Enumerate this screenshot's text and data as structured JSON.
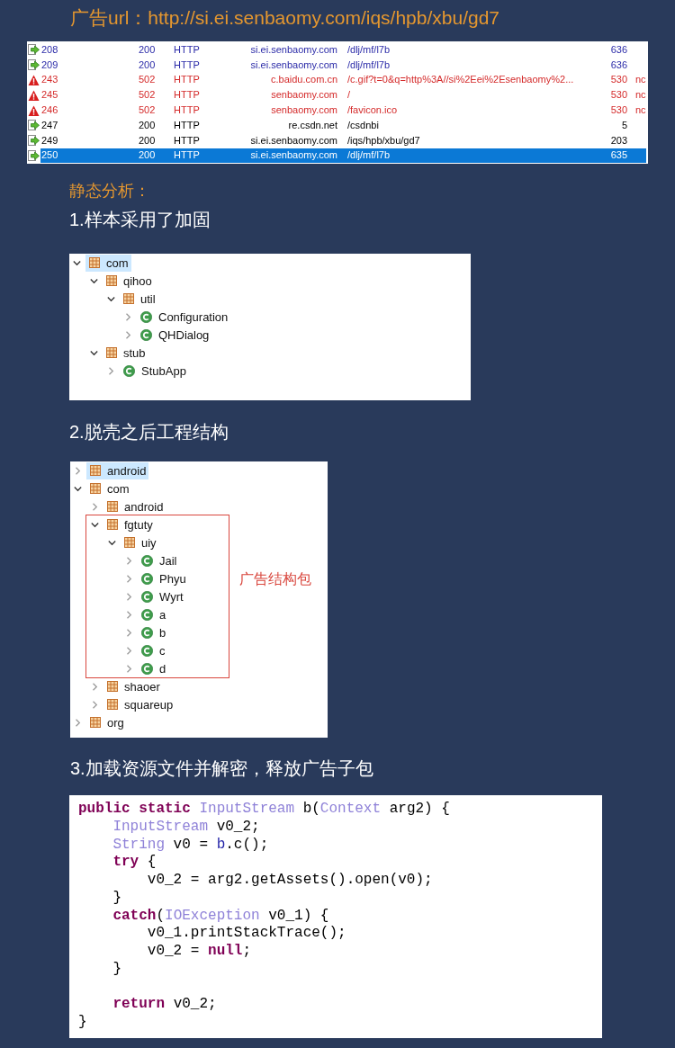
{
  "ad_url_heading": "广告url：http://si.ei.senbaomy.com/iqs/hpb/xbu/gd7",
  "sessions": {
    "rows": [
      {
        "kind": "ok",
        "selected": false,
        "color": "#2b2ba8",
        "cells": [
          "208",
          "200",
          "HTTP",
          "si.ei.senbaomy.com",
          "/dlj/mf/l7b",
          "636"
        ]
      },
      {
        "kind": "ok",
        "selected": false,
        "color": "#2b2ba8",
        "cells": [
          "209",
          "200",
          "HTTP",
          "si.ei.senbaomy.com",
          "/dlj/mf/l7b",
          "636"
        ]
      },
      {
        "kind": "error",
        "selected": false,
        "color": "#d42a2a",
        "cells": [
          "243",
          "502",
          "HTTP",
          "c.baidu.com.cn",
          "/c.gif?t=0&q=http%3A//si%2Eei%2Esenbaomy%2...",
          "530",
          "nc"
        ]
      },
      {
        "kind": "error",
        "selected": false,
        "color": "#d42a2a",
        "cells": [
          "245",
          "502",
          "HTTP",
          "senbaomy.com",
          "/",
          "530",
          "nc"
        ]
      },
      {
        "kind": "error",
        "selected": false,
        "color": "#d42a2a",
        "cells": [
          "246",
          "502",
          "HTTP",
          "senbaomy.com",
          "/favicon.ico",
          "530",
          "nc"
        ]
      },
      {
        "kind": "ok",
        "selected": false,
        "color": "#000000",
        "cells": [
          "247",
          "200",
          "HTTP",
          "re.csdn.net",
          "/csdnbi",
          "5"
        ]
      },
      {
        "kind": "ok",
        "selected": false,
        "color": "#000000",
        "cells": [
          "249",
          "200",
          "HTTP",
          "si.ei.senbaomy.com",
          "/iqs/hpb/xbu/gd7",
          "203"
        ]
      },
      {
        "kind": "ok",
        "selected": true,
        "cells": [
          "250",
          "200",
          "HTTP",
          "si.ei.senbaomy.com",
          "/dlj/mf/l7b",
          "635"
        ]
      }
    ]
  },
  "analysis_heading": "静态分析：",
  "steps": [
    {
      "title": "1.样本采用了加固",
      "kind": "tree",
      "tree": [
        {
          "label": "com",
          "kind": "package",
          "expanded": true,
          "selected": true,
          "children": [
            {
              "label": "qihoo",
              "kind": "package",
              "expanded": true,
              "selected": false,
              "children": [
                {
                  "label": "util",
                  "kind": "package",
                  "expanded": true,
                  "selected": false,
                  "children": [
                    {
                      "label": "Configuration",
                      "kind": "class",
                      "expanded": false,
                      "selected": false
                    },
                    {
                      "label": "QHDialog",
                      "kind": "class",
                      "expanded": false,
                      "selected": false
                    }
                  ]
                }
              ]
            },
            {
              "label": "stub",
              "kind": "package",
              "expanded": true,
              "selected": false,
              "children": [
                {
                  "label": "StubApp",
                  "kind": "class",
                  "expanded": false,
                  "selected": false
                }
              ]
            }
          ]
        }
      ]
    },
    {
      "title": "2.脱壳之后工程结构",
      "kind": "tree",
      "tree": [
        {
          "label": "android",
          "kind": "package",
          "expanded": false,
          "selected": true
        },
        {
          "label": "com",
          "kind": "package",
          "expanded": true,
          "selected": false,
          "children": [
            {
              "label": "android",
              "kind": "package",
              "expanded": false,
              "selected": false
            },
            {
              "label": "fgtuty",
              "kind": "package",
              "expanded": true,
              "selected": false,
              "callout": "广告结构包",
              "children": [
                {
                  "label": "uiy",
                  "kind": "package",
                  "expanded": true,
                  "selected": false,
                  "children": [
                    {
                      "label": "Jail",
                      "kind": "class",
                      "expanded": false,
                      "selected": false
                    },
                    {
                      "label": "Phyu",
                      "kind": "class",
                      "expanded": false,
                      "selected": false
                    },
                    {
                      "label": "Wyrt",
                      "kind": "class",
                      "expanded": false,
                      "selected": false
                    },
                    {
                      "label": "a",
                      "kind": "class",
                      "expanded": false,
                      "selected": false
                    },
                    {
                      "label": "b",
                      "kind": "class",
                      "expanded": false,
                      "selected": false
                    },
                    {
                      "label": "c",
                      "kind": "class",
                      "expanded": false,
                      "selected": false
                    },
                    {
                      "label": "d",
                      "kind": "class",
                      "expanded": false,
                      "selected": false
                    }
                  ]
                }
              ]
            },
            {
              "label": "shaoer",
              "kind": "package",
              "expanded": false,
              "selected": false
            },
            {
              "label": "squareup",
              "kind": "package",
              "expanded": false,
              "selected": false
            }
          ]
        },
        {
          "label": "org",
          "kind": "package",
          "expanded": false,
          "selected": false
        }
      ]
    },
    {
      "title": "3.加载资源文件并解密，释放广告子包",
      "kind": "code",
      "code": [
        {
          "kind": "code",
          "tokens": [
            {
              "text": "public static ",
              "kind": "keyword"
            },
            {
              "text": "InputStream",
              "kind": "type"
            },
            {
              "text": " b(",
              "kind": "plain"
            },
            {
              "text": "Context",
              "kind": "type"
            },
            {
              "text": " arg2) {",
              "kind": "plain"
            }
          ],
          "children": [
            {
              "kind": "code",
              "tokens": [
                {
                  "text": "InputStream",
                  "kind": "type"
                },
                {
                  "text": " v0_2;",
                  "kind": "plain"
                }
              ]
            },
            {
              "kind": "code",
              "tokens": [
                {
                  "text": "String",
                  "kind": "type"
                },
                {
                  "text": " v0 = ",
                  "kind": "plain"
                },
                {
                  "text": "b",
                  "kind": "class_ref"
                },
                {
                  "text": ".c();",
                  "kind": "plain"
                }
              ]
            },
            {
              "kind": "code",
              "tokens": [
                {
                  "text": "try ",
                  "kind": "keyword"
                },
                {
                  "text": "{",
                  "kind": "plain"
                }
              ],
              "children": [
                {
                  "kind": "code",
                  "tokens": [
                    {
                      "text": "v0_2 = arg2.getAssets().open(v0);",
                      "kind": "plain"
                    }
                  ]
                }
              ]
            },
            {
              "kind": "code",
              "tokens": [
                {
                  "text": "}",
                  "kind": "plain"
                }
              ]
            },
            {
              "kind": "code",
              "tokens": [
                {
                  "text": "catch",
                  "kind": "keyword"
                },
                {
                  "text": "(",
                  "kind": "plain"
                },
                {
                  "text": "IOException",
                  "kind": "type"
                },
                {
                  "text": " v0_1) {",
                  "kind": "plain"
                }
              ],
              "children": [
                {
                  "kind": "code",
                  "tokens": [
                    {
                      "text": "v0_1.printStackTrace();",
                      "kind": "plain"
                    }
                  ]
                },
                {
                  "kind": "code",
                  "tokens": [
                    {
                      "text": "v0_2 = ",
                      "kind": "plain"
                    },
                    {
                      "text": "null",
                      "kind": "keyword"
                    },
                    {
                      "text": ";",
                      "kind": "plain"
                    }
                  ]
                }
              ]
            },
            {
              "kind": "code",
              "tokens": [
                {
                  "text": "}",
                  "kind": "plain"
                }
              ]
            },
            {
              "kind": "blank"
            },
            {
              "kind": "code",
              "tokens": [
                {
                  "text": "return ",
                  "kind": "keyword"
                },
                {
                  "text": "v0_2;",
                  "kind": "plain"
                }
              ]
            }
          ]
        },
        {
          "kind": "code",
          "tokens": [
            {
              "text": "}",
              "kind": "plain"
            }
          ]
        }
      ]
    }
  ]
}
